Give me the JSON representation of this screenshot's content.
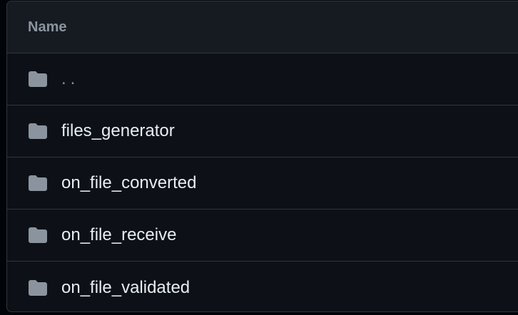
{
  "table": {
    "header_label": "Name",
    "rows": [
      {
        "name": "..",
        "icon": "folder-icon"
      },
      {
        "name": "files_generator",
        "icon": "folder-icon"
      },
      {
        "name": "on_file_converted",
        "icon": "folder-icon"
      },
      {
        "name": "on_file_receive",
        "icon": "folder-icon"
      },
      {
        "name": "on_file_validated",
        "icon": "folder-icon"
      }
    ]
  },
  "colors": {
    "background": "#0d1117",
    "header_background": "#161b22",
    "border": "#30363d",
    "folder_icon": "#8b949e",
    "text": "#e6edf3",
    "muted_text": "#8b949e"
  }
}
